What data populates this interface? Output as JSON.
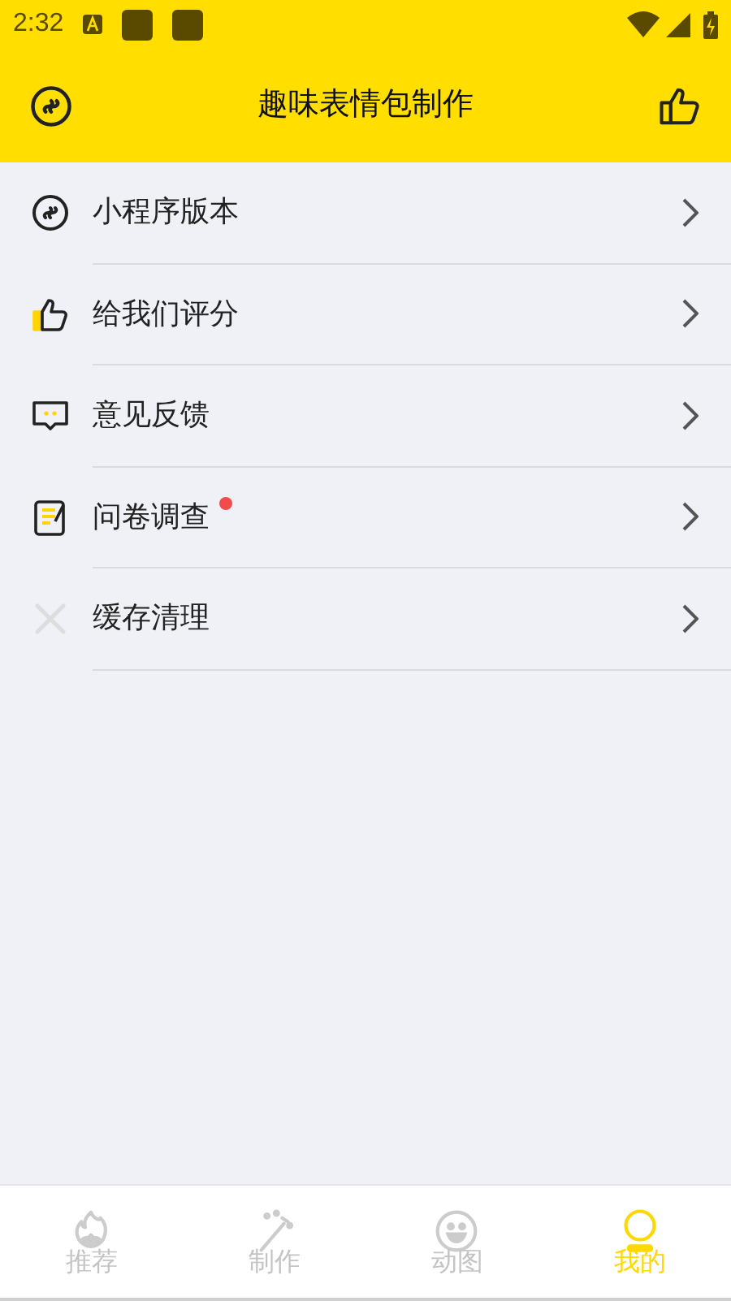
{
  "status_bar": {
    "time": "2:32"
  },
  "header": {
    "title": "趣味表情包制作"
  },
  "menu": [
    {
      "kind": "link",
      "label": "小程序版本",
      "badge": false
    },
    {
      "kind": "thumb",
      "label": "给我们评分",
      "badge": false
    },
    {
      "kind": "chat",
      "label": "意见反馈",
      "badge": false
    },
    {
      "kind": "note",
      "label": "问卷调查",
      "badge": true
    },
    {
      "kind": "clear",
      "label": "缓存清理",
      "badge": false
    }
  ],
  "tabs": [
    {
      "kind": "fire",
      "label": "推荐",
      "selected": false
    },
    {
      "kind": "wand",
      "label": "制作",
      "selected": false
    },
    {
      "kind": "smile",
      "label": "动图",
      "selected": false
    },
    {
      "kind": "user",
      "label": "我的",
      "selected": true
    }
  ]
}
